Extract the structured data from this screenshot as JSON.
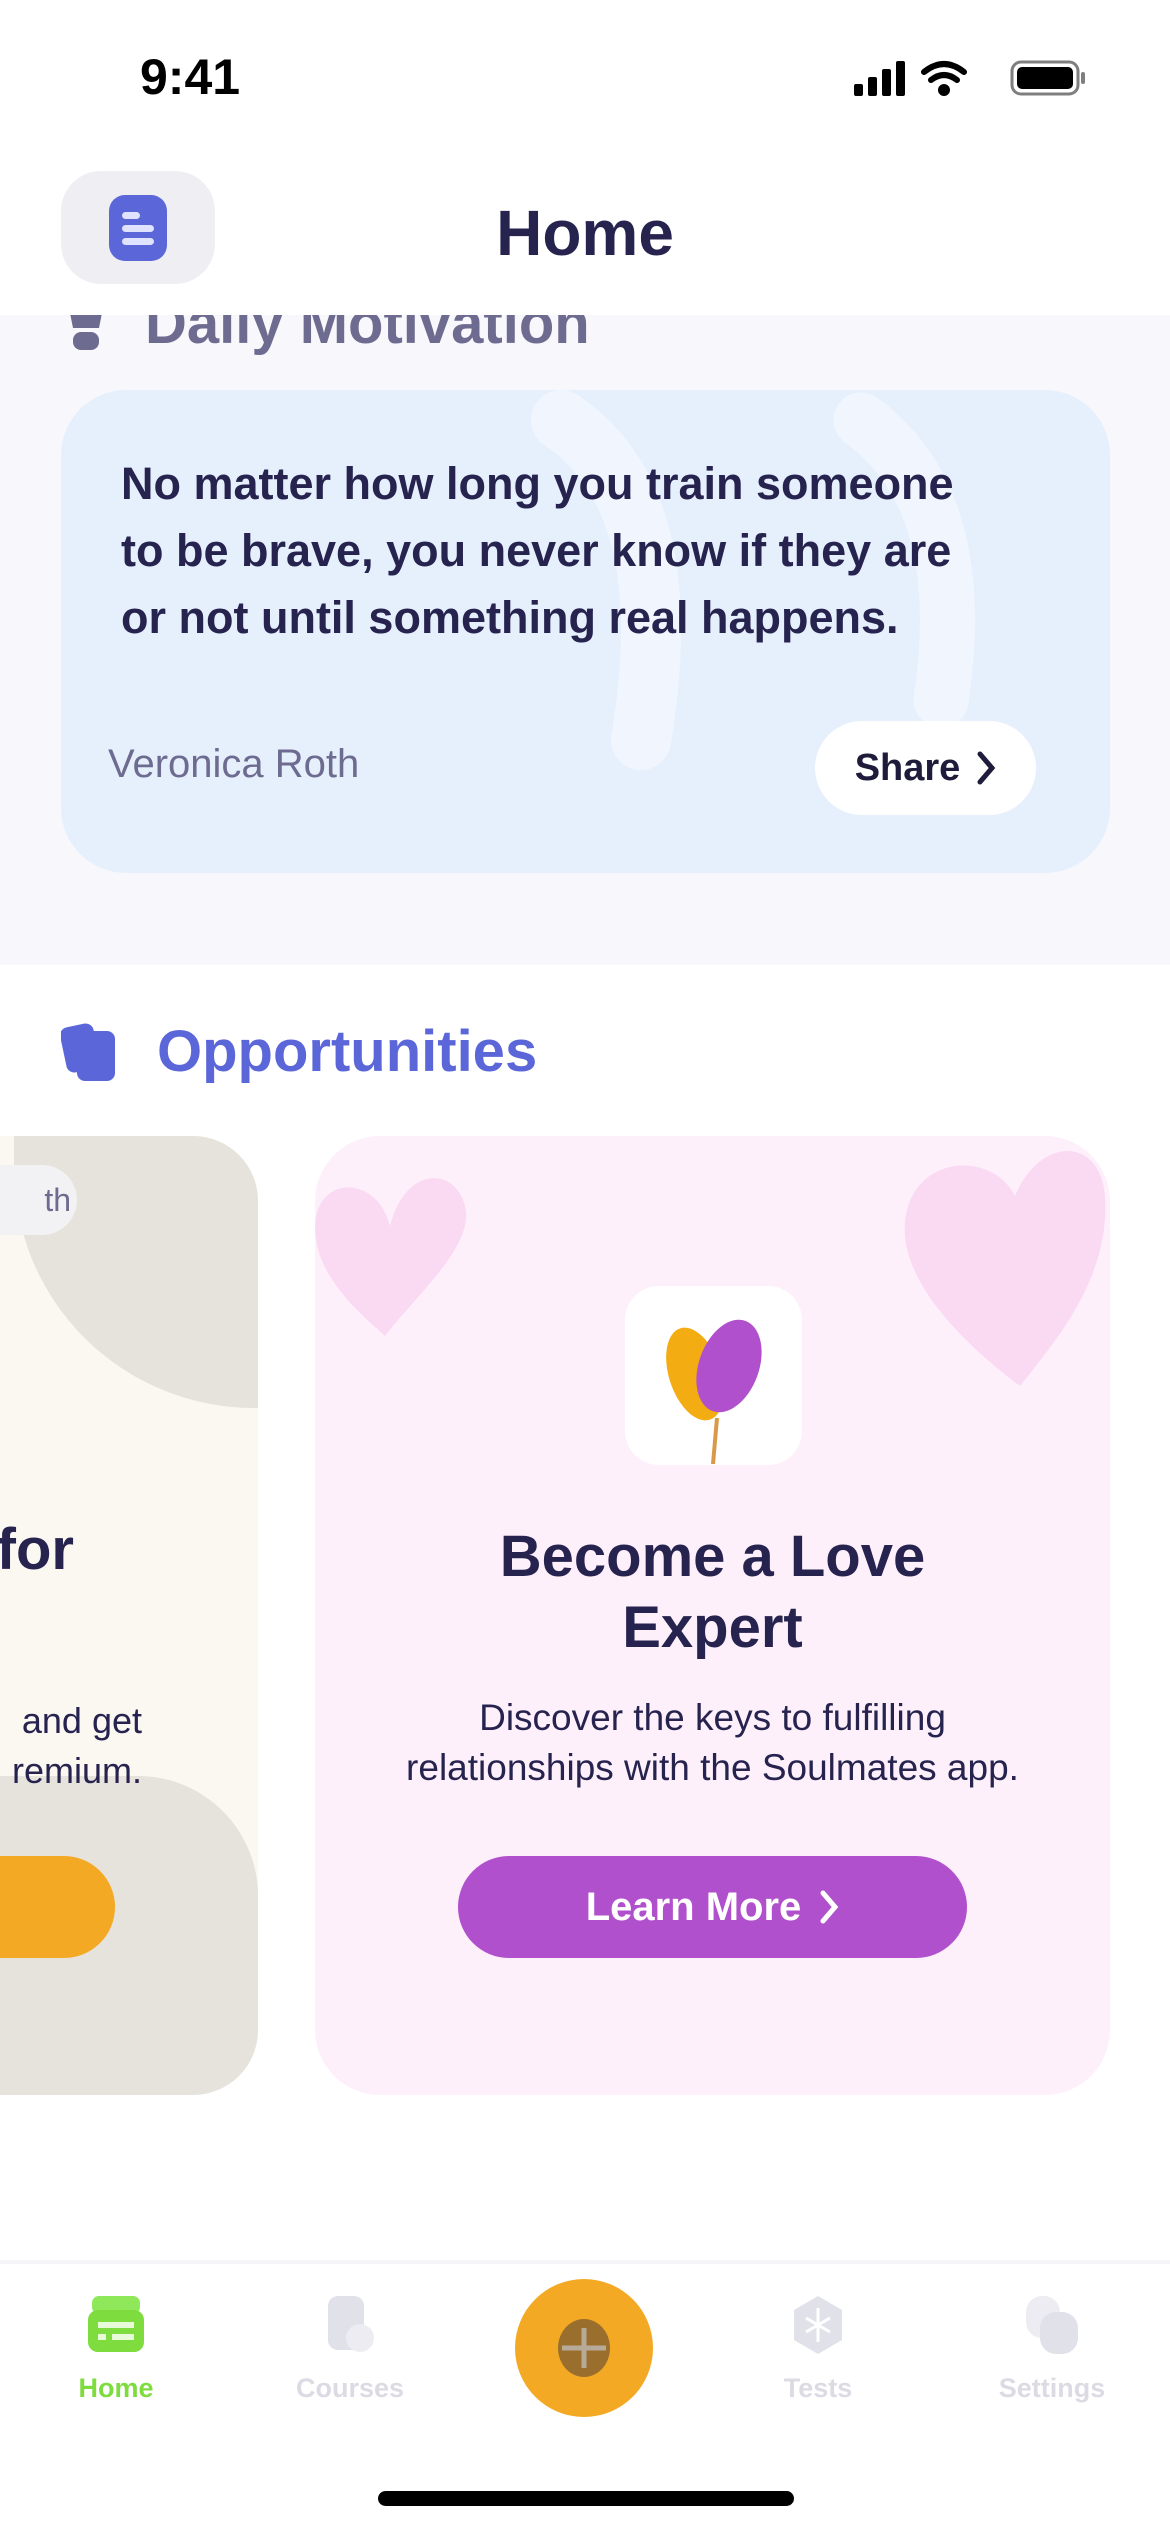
{
  "status_bar": {
    "time": "9:41"
  },
  "header": {
    "title": "Home",
    "menu_icon": "menu-icon"
  },
  "daily_motivation": {
    "heading": "Daily Motivation",
    "quote": "No matter how long you train someone to be brave, you never know if they are or not until something real happens.",
    "author": "Veronica Roth",
    "share_label": "Share"
  },
  "opportunities": {
    "heading": "Opportunities",
    "cards": [
      {
        "badge": "th",
        "title": "for",
        "description_line1": "and get",
        "description_line2": "remium.",
        "accent": "#f4a924"
      },
      {
        "title_line1": "Become a Love",
        "title_line2": "Expert",
        "description_line1": "Discover the keys to fulfilling",
        "description_line2": "relationships with the Soulmates app.",
        "button_label": "Learn More",
        "accent": "#b150cc"
      }
    ]
  },
  "tab_bar": {
    "items": [
      {
        "label": "Home",
        "active": true,
        "icon": "home-icon"
      },
      {
        "label": "Courses",
        "active": false,
        "icon": "courses-icon"
      },
      {
        "label": "",
        "icon": "plus-icon"
      },
      {
        "label": "Tests",
        "active": false,
        "icon": "tests-icon"
      },
      {
        "label": "Settings",
        "active": false,
        "icon": "settings-icon"
      }
    ],
    "active_color": "#7fdc3f"
  }
}
